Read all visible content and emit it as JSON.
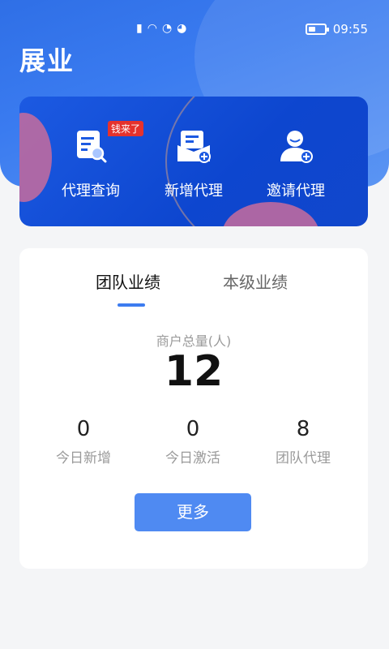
{
  "status_bar": {
    "time": "09:55",
    "icons": [
      "alert-icon",
      "wifi-icon",
      "hotspot-icon",
      "nfc-icon"
    ]
  },
  "header": {
    "title": "展业"
  },
  "quick_actions": [
    {
      "label": "代理查询",
      "icon": "agent-query-icon",
      "badge": "钱来了"
    },
    {
      "label": "新增代理",
      "icon": "add-agent-icon"
    },
    {
      "label": "邀请代理",
      "icon": "invite-agent-icon"
    }
  ],
  "performance": {
    "tabs": [
      "团队业绩",
      "本级业绩"
    ],
    "active_tab": "团队业绩",
    "total_label": "商户总量(人)",
    "total_value": "12",
    "stats": [
      {
        "value": "0",
        "label": "今日新增"
      },
      {
        "value": "0",
        "label": "今日激活"
      },
      {
        "value": "8",
        "label": "团队代理"
      }
    ],
    "more_label": "更多"
  },
  "colors": {
    "header": "#3a7bf0",
    "banner": "#1253d8",
    "accent": "#4f8af2",
    "badge": "#e5322d"
  }
}
